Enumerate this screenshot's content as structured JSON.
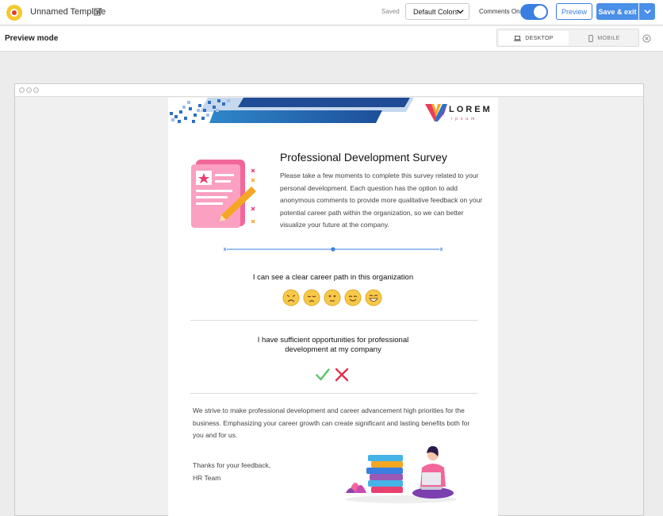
{
  "topbar": {
    "template_name": "Unnamed Template",
    "saved_status": "Saved",
    "colors_select": "Default Colors",
    "comments_label": "Comments On",
    "comments_on": true,
    "preview_label": "Preview",
    "save_label": "Save & exit",
    "accent_color": "#3a7ee0"
  },
  "modebar": {
    "title": "Preview mode",
    "desktop_label": "DESKTOP",
    "mobile_label": "MOBILE",
    "selected_device": "DESKTOP"
  },
  "email": {
    "brand_name": "LOREM",
    "brand_sub": "ipsum",
    "intro_title": "Professional Development Survey",
    "intro_text": "Please take a few moments to complete this survey related to your personal development. Each question has the option to add anonymous comments to provide more qualitative feedback on your potential career path within the organization, so we can better visualize your future at the company.",
    "question1": "I can see a clear career path in this organization",
    "question1_options": [
      "very-sad-emoji",
      "sad-emoji",
      "neutral-emoji",
      "happy-emoji",
      "very-happy-emoji"
    ],
    "question2_line1": "I have sufficient opportunities for professional",
    "question2_line2": "development at my company",
    "question2_options": [
      "yes-check",
      "no-cross"
    ],
    "closing_text": "We strive to make professional development and career advancement high priorities for the business. Emphasizing your career growth can create significant and lasting benefits both for you and for us.",
    "thanks_line": "Thanks for your feedback,",
    "signature": "HR Team"
  }
}
